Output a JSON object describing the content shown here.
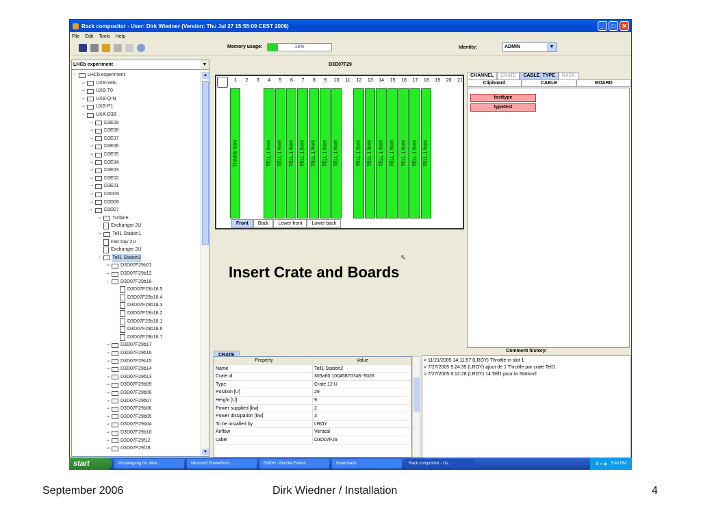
{
  "window": {
    "title": "Rack compositor - User: Dirk Wiedner (Version: Thu Jul 27 15:55:09 CEST 2006)"
  },
  "menu": [
    "File",
    "Edit",
    "Tools",
    "Help"
  ],
  "toolbar": {
    "memory_label": "Memory usage:",
    "memory_percent": 16,
    "memory_text": "16%",
    "identity_label": "Identity:",
    "identity_value": "ADMIN"
  },
  "tree": {
    "root_combo": "LHCb experiment",
    "nodes": [
      {
        "label": "LHCb experiment",
        "depth": 0,
        "type": "folder",
        "open": true
      },
      {
        "label": "UXB-Velo",
        "depth": 1,
        "type": "folder"
      },
      {
        "label": "UXB-T0",
        "depth": 1,
        "type": "folder"
      },
      {
        "label": "UXB-Q-N",
        "depth": 1,
        "type": "folder"
      },
      {
        "label": "UXB-P1",
        "depth": 1,
        "type": "folder"
      },
      {
        "label": "UXA-D3B",
        "depth": 1,
        "type": "folder",
        "open": true
      },
      {
        "label": "D3E09",
        "depth": 2,
        "type": "folder"
      },
      {
        "label": "D3E08",
        "depth": 2,
        "type": "folder"
      },
      {
        "label": "D3E07",
        "depth": 2,
        "type": "folder"
      },
      {
        "label": "D3E06",
        "depth": 2,
        "type": "folder"
      },
      {
        "label": "D3E05",
        "depth": 2,
        "type": "folder"
      },
      {
        "label": "D3E04",
        "depth": 2,
        "type": "folder"
      },
      {
        "label": "D3E03",
        "depth": 2,
        "type": "folder"
      },
      {
        "label": "D3E02",
        "depth": 2,
        "type": "folder"
      },
      {
        "label": "D3E01",
        "depth": 2,
        "type": "folder"
      },
      {
        "label": "D3D09",
        "depth": 2,
        "type": "folder"
      },
      {
        "label": "D3D08",
        "depth": 2,
        "type": "folder"
      },
      {
        "label": "D3D07",
        "depth": 2,
        "type": "folder",
        "open": true
      },
      {
        "label": "Turbine",
        "depth": 3,
        "type": "folder"
      },
      {
        "label": "Exchanger 2U",
        "depth": 3,
        "type": "doc"
      },
      {
        "label": "Tell1 Station1",
        "depth": 3,
        "type": "folder"
      },
      {
        "label": "Fan tray 2U",
        "depth": 3,
        "type": "doc"
      },
      {
        "label": "Exchanger 2U",
        "depth": 3,
        "type": "doc"
      },
      {
        "label": "Tell1 Station2",
        "depth": 3,
        "type": "folder",
        "open": true,
        "selected": true
      },
      {
        "label": "D3D07F29b01",
        "depth": 4,
        "type": "folder"
      },
      {
        "label": "D3D07F29b12",
        "depth": 4,
        "type": "folder"
      },
      {
        "label": "D3D07F29b18",
        "depth": 4,
        "type": "folder",
        "open": true
      },
      {
        "label": "D3D07F29b18.5",
        "depth": 5,
        "type": "doc"
      },
      {
        "label": "D3D07F29b18.4",
        "depth": 5,
        "type": "doc"
      },
      {
        "label": "D3D07F29b18.3",
        "depth": 5,
        "type": "doc"
      },
      {
        "label": "D3D07F29b18.2",
        "depth": 5,
        "type": "doc"
      },
      {
        "label": "D3D07F29b18.1",
        "depth": 5,
        "type": "doc"
      },
      {
        "label": "D3D07F29b18.6",
        "depth": 5,
        "type": "doc"
      },
      {
        "label": "D3D07F29b18.7",
        "depth": 5,
        "type": "doc"
      },
      {
        "label": "D3D07F29b17",
        "depth": 4,
        "type": "folder"
      },
      {
        "label": "D3D07F29b16",
        "depth": 4,
        "type": "folder"
      },
      {
        "label": "D3D07F29b15",
        "depth": 4,
        "type": "folder"
      },
      {
        "label": "D3D07F29b14",
        "depth": 4,
        "type": "folder"
      },
      {
        "label": "D3D07F29b13",
        "depth": 4,
        "type": "folder"
      },
      {
        "label": "D3D07F29b09",
        "depth": 4,
        "type": "folder"
      },
      {
        "label": "D3D07F29b08",
        "depth": 4,
        "type": "folder"
      },
      {
        "label": "D3D07F29b07",
        "depth": 4,
        "type": "folder"
      },
      {
        "label": "D3D07F29b06",
        "depth": 4,
        "type": "folder"
      },
      {
        "label": "D3D07F29b05",
        "depth": 4,
        "type": "folder"
      },
      {
        "label": "D3D07F29b04",
        "depth": 4,
        "type": "folder"
      },
      {
        "label": "D3D07F29b10",
        "depth": 4,
        "type": "folder"
      },
      {
        "label": "D3D07F29f12",
        "depth": 4,
        "type": "folder"
      },
      {
        "label": "D3D07F29f18",
        "depth": 4,
        "type": "folder"
      }
    ]
  },
  "crate": {
    "title": "D3D07F29",
    "slots": [
      "1",
      "2",
      "3",
      "4",
      "5",
      "6",
      "7",
      "8",
      "9",
      "10",
      "11",
      "12",
      "13",
      "14",
      "15",
      "16",
      "17",
      "18",
      "19",
      "20",
      "21"
    ],
    "boards": [
      {
        "slot": 1,
        "label": "Throttle front"
      },
      {
        "slot": 4,
        "label": "TELL 1 front"
      },
      {
        "slot": 5,
        "label": "TELL 1 front"
      },
      {
        "slot": 6,
        "label": "TELL 1 front"
      },
      {
        "slot": 7,
        "label": "TELL 1 front"
      },
      {
        "slot": 8,
        "label": "TELL 1 front"
      },
      {
        "slot": 9,
        "label": "TELL 1 front"
      },
      {
        "slot": 10,
        "label": "TELL 1 front"
      },
      {
        "slot": 12,
        "label": "TELL 1 front"
      },
      {
        "slot": 13,
        "label": "TELL 1 front"
      },
      {
        "slot": 14,
        "label": "TELL 1 front"
      },
      {
        "slot": 15,
        "label": "TELL 1 front"
      },
      {
        "slot": 16,
        "label": "TELL 1 front"
      },
      {
        "slot": 17,
        "label": "TELL 1 front"
      },
      {
        "slot": 18,
        "label": "TELL 1 front"
      }
    ],
    "view_tabs": [
      "Front",
      "Back",
      "Lower front",
      "Lower back"
    ],
    "active_view_tab": 0
  },
  "caption": "Insert Crate and Boards",
  "right_panel": {
    "tabs": [
      "CHANNEL",
      "CRATE",
      "CABLE_TYPE",
      "RACK"
    ],
    "subtabs": [
      "Clipboard",
      "CABLE",
      "BOARD"
    ],
    "items": [
      "testtype",
      "typetest"
    ]
  },
  "properties": {
    "tab": "CRATE",
    "headers": [
      "Property",
      "Value"
    ],
    "rows": [
      [
        "Name",
        "Tell1 Station2"
      ],
      [
        "Crate id",
        "303a60:10045870748:-5026"
      ],
      [
        "Type",
        "Crate 12 U"
      ],
      [
        "Position [U]",
        "29"
      ],
      [
        "Height [U]",
        "9"
      ],
      [
        "Power supplied [kw]",
        "2"
      ],
      [
        "Power dissipation [kw]",
        "3"
      ],
      [
        "To be installed by",
        "LROY"
      ],
      [
        "Airflow",
        "Vertical"
      ],
      [
        "Label",
        "D3D07F29"
      ]
    ]
  },
  "comments": {
    "title": "Comment history:",
    "lines": [
      "> 11/21/2005 14:11:57 (LROY) Throttle in slot 1",
      "> 7/27/2005 9:24:35 (LROY) ajout de 1 Throttle par crate Tell1",
      "> 7/27/2005 9:12:28 (LROY) 14 Tell1 pour la Station2"
    ]
  },
  "taskbar": {
    "start": "start",
    "tasks": [
      "Posteingang für dwie...",
      "Microsoft PowerPoint ...",
      "EMDH - Mozilla Firefox",
      "Downloads",
      "Rack compositor - Us..."
    ],
    "active_task": 4,
    "clock": "5:43 PM"
  },
  "footer": {
    "date": "September 2006",
    "author": "Dirk Wiedner / Installation",
    "page": "4"
  }
}
